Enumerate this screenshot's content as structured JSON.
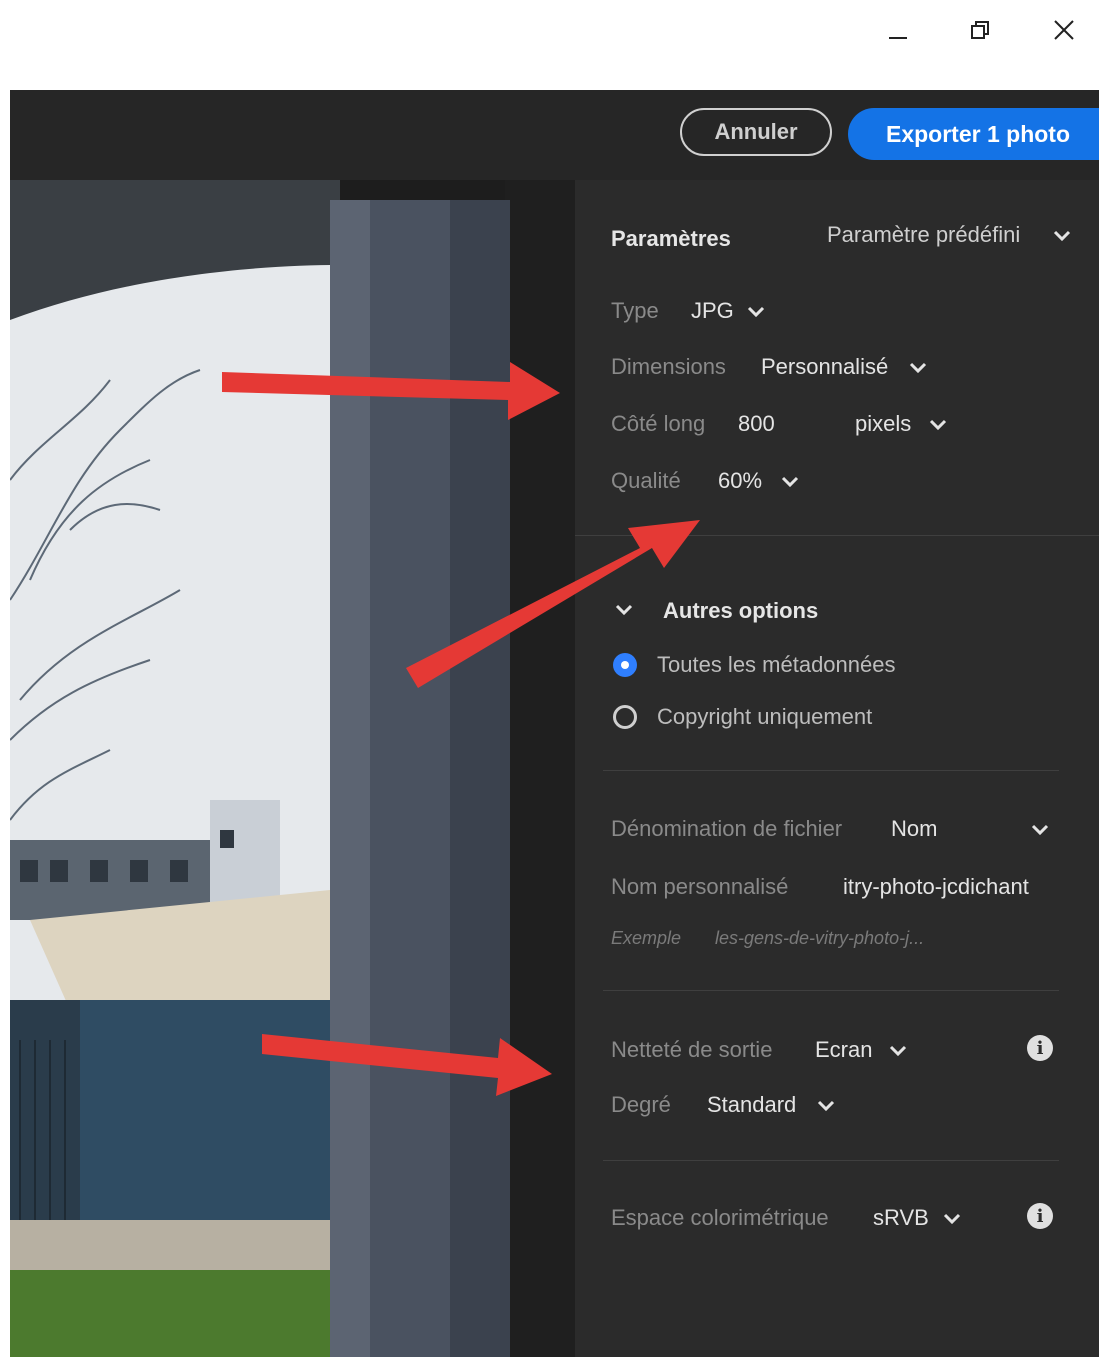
{
  "window": {
    "minimize_icon": "minimize-icon",
    "maximize_icon": "restore-icon",
    "close_icon": "close-icon"
  },
  "header": {
    "cancel_label": "Annuler",
    "export_label": "Exporter 1 photo"
  },
  "settings": {
    "title": "Paramètres",
    "preset_label": "Paramètre prédéfini",
    "type_label": "Type",
    "type_value": "JPG",
    "dimensions_label": "Dimensions",
    "dimensions_value": "Personnalisé",
    "long_side_label": "Côté long",
    "long_side_value": "800",
    "long_side_unit": "pixels",
    "quality_label": "Qualité",
    "quality_value": "60%"
  },
  "other_options": {
    "title": "Autres options",
    "radio_all_metadata": "Toutes les métadonnées",
    "radio_copyright_only": "Copyright uniquement",
    "selected": "Toutes les métadonnées"
  },
  "file_naming": {
    "label": "Dénomination de fichier",
    "value": "Nom",
    "custom_name_label": "Nom personnalisé",
    "custom_name_value": "itry-photo-jcdichant",
    "example_label": "Exemple",
    "example_value": "les-gens-de-vitry-photo-j..."
  },
  "sharpening": {
    "label": "Netteté de sortie",
    "value": "Ecran",
    "degree_label": "Degré",
    "degree_value": "Standard"
  },
  "color_space": {
    "label": "Espace colorimétrique",
    "value": "sRVB"
  },
  "colors": {
    "accent": "#1473e6",
    "panel_bg": "#2b2b2b",
    "arrow": "#e53935"
  }
}
